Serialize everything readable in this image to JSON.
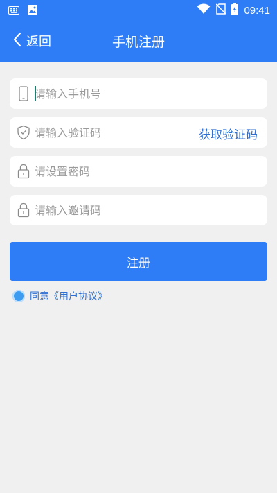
{
  "status_bar": {
    "time": "09:41",
    "icons": [
      "keyboard-icon",
      "image-icon",
      "wifi-icon",
      "no-sim-icon",
      "battery-icon"
    ]
  },
  "header": {
    "back_label": "返回",
    "title": "手机注册"
  },
  "form": {
    "phone_placeholder": "请输入手机号",
    "code_placeholder": "请输入验证码",
    "get_code_label": "获取验证码",
    "password_placeholder": "请设置密码",
    "invite_placeholder": "请输入邀请码"
  },
  "register_label": "注册",
  "agreement": {
    "text": "同意《用户协议》"
  },
  "colors": {
    "primary": "#2e7df6",
    "background": "#f0f0f0",
    "link": "#2e6fd1"
  }
}
